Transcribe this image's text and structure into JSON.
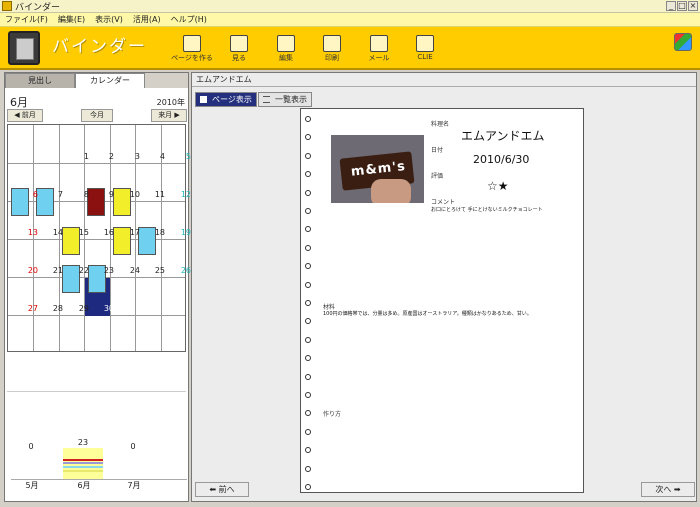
{
  "window": {
    "title": "バインダー"
  },
  "menu": [
    "ファイル(F)",
    "編集(E)",
    "表示(V)",
    "活用(A)",
    "ヘルプ(H)"
  ],
  "brand": {
    "title": "バインダー"
  },
  "toolbar": [
    {
      "label": "ページを作る",
      "icon": "create-page-icon"
    },
    {
      "label": "見る",
      "icon": "view-book-icon"
    },
    {
      "label": "編集",
      "icon": "edit-icon"
    },
    {
      "label": "印刷",
      "icon": "printer-icon"
    },
    {
      "label": "メール",
      "icon": "mail-icon"
    },
    {
      "label": "CLIE",
      "icon": "clie-device-icon"
    }
  ],
  "left": {
    "tabs": [
      "見出し",
      "カレンダー"
    ],
    "month": "6月",
    "year": "2010年",
    "prev_label": "前月",
    "today_label": "今月",
    "next_label": "来月",
    "chart": {
      "months": [
        "5月",
        "6月",
        "7月"
      ],
      "counts": [
        "0",
        "23",
        "0"
      ]
    }
  },
  "calendar_days": [
    "1",
    "2",
    "3",
    "4",
    "5",
    "6",
    "7",
    "8",
    "9",
    "10",
    "11",
    "12",
    "13",
    "14",
    "15",
    "16",
    "17",
    "18",
    "19",
    "20",
    "21",
    "22",
    "23",
    "24",
    "25",
    "26",
    "27",
    "28",
    "29",
    "30"
  ],
  "right": {
    "title": "エムアンドエム",
    "page_view_label": "ページ表示",
    "list_view_label": "一覧表示",
    "prev_label": "前へ",
    "next_label": "次へ"
  },
  "recipe": {
    "name_label": "料理名",
    "name": "エムアンドエム",
    "date_label": "日付",
    "date": "2010/6/30",
    "rating_label": "評価",
    "rating": "☆★",
    "comment_label": "コメント",
    "comment": "お口にとろけて 手にとけないミルクチョコレート",
    "ingredients_label": "材料",
    "ingredients": "100円の価格帯では、分量は多め。原産国はオーストラリア。種類はかなりあるため、甘い。",
    "method_label": "作り方",
    "photo_text": "m&m's"
  },
  "colors": {
    "brand": "#ffcc00",
    "selected": "#1e2a80",
    "sunday": "#dd0000",
    "saturday": "#22bbbb"
  }
}
